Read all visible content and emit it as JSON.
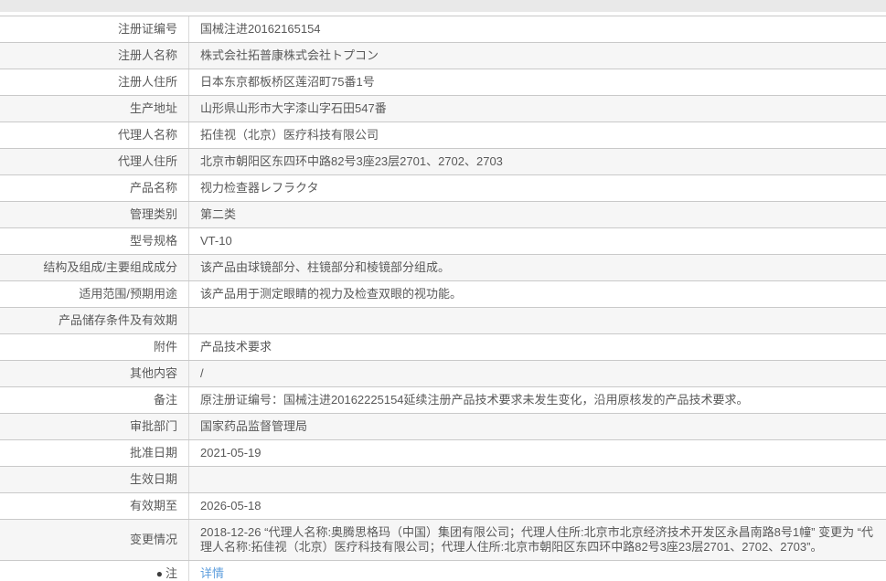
{
  "page": {
    "description": "医疗器械注册信息表",
    "colors": {
      "top_bar_bg": "#e9e9e9",
      "row_alt_bg": "#f6f6f6",
      "border": "#c9c9c9",
      "text": "#595959",
      "link": "#5e9edd"
    }
  },
  "table": {
    "rows": [
      {
        "label": "注册证编号",
        "value": "国械注进20162165154"
      },
      {
        "label": "注册人名称",
        "value": "株式会社拓普康株式会社トプコン"
      },
      {
        "label": "注册人住所",
        "value": "日本东京都板桥区莲沼町75番1号"
      },
      {
        "label": "生产地址",
        "value": "山形県山形市大字漆山字石田547番"
      },
      {
        "label": "代理人名称",
        "value": "拓佳视（北京）医疗科技有限公司"
      },
      {
        "label": "代理人住所",
        "value": "北京市朝阳区东四环中路82号3座23层2701、2702、2703"
      },
      {
        "label": "产品名称",
        "value": "视力检查器レフラクタ"
      },
      {
        "label": "管理类别",
        "value": "第二类"
      },
      {
        "label": "型号规格",
        "value": "VT-10"
      },
      {
        "label": "结构及组成/主要组成成分",
        "value": "该产品由球镜部分、柱镜部分和棱镜部分组成。"
      },
      {
        "label": "适用范围/预期用途",
        "value": "该产品用于测定眼睛的视力及检查双眼的视功能。"
      },
      {
        "label": "产品储存条件及有效期",
        "value": ""
      },
      {
        "label": "附件",
        "value": "产品技术要求"
      },
      {
        "label": "其他内容",
        "value": "/"
      },
      {
        "label": "备注",
        "value": "原注册证编号：国械注进20162225154延续注册产品技术要求未发生变化，沿用原核发的产品技术要求。"
      },
      {
        "label": "审批部门",
        "value": "国家药品监督管理局"
      },
      {
        "label": "批准日期",
        "value": "2021-05-19"
      },
      {
        "label": "生效日期",
        "value": ""
      },
      {
        "label": "有效期至",
        "value": "2026-05-18"
      },
      {
        "label": "变更情况",
        "value": "2018-12-26  “代理人名称:奥腾思格玛（中国）集团有限公司；代理人住所:北京市北京经济技术开发区永昌南路8号1幢” 变更为 “代理人名称:拓佳视（北京）医疗科技有限公司；代理人住所:北京市朝阳区东四环中路82号3座23层2701、2702、2703”。"
      },
      {
        "label": "注",
        "bullet": "●",
        "value": "详情"
      }
    ]
  }
}
